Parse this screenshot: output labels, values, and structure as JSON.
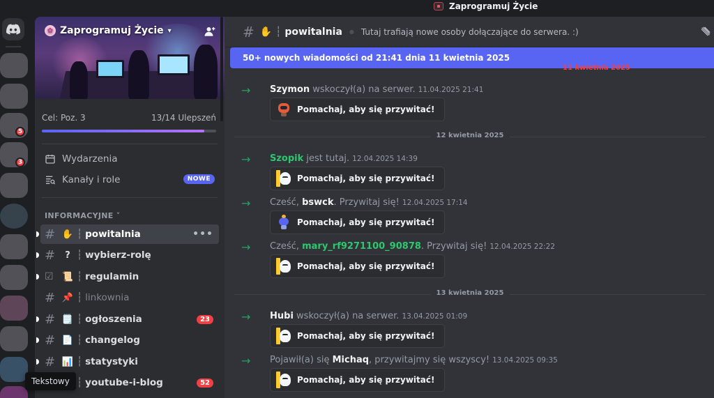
{
  "window": {
    "title": "Zaprogramuj Życie"
  },
  "rail": {
    "badges": [
      "5",
      "3"
    ]
  },
  "server": {
    "name": "Zaprogramuj Życie",
    "boost_goal": "Cel: Poz. 3",
    "boost_count": "13/14 Ulepszeń",
    "boost_progress": 0.93
  },
  "sidebar": {
    "events_label": "Wydarzenia",
    "channels_roles_label": "Kanały i role",
    "new_badge": "NOWE",
    "category": "INFORMACYJNE",
    "channels": [
      {
        "emoji": "✋",
        "name": "powitalnia",
        "active": true
      },
      {
        "emoji": "?",
        "name": "wybierz-rolę"
      },
      {
        "emoji": "📜",
        "name": "regulamin"
      },
      {
        "emoji": "📌",
        "name": "linkownia",
        "muted": true
      },
      {
        "emoji": "🗒️",
        "name": "ogłoszenia",
        "count": "23"
      },
      {
        "emoji": "📄",
        "name": "changelog"
      },
      {
        "emoji": "📊",
        "name": "statystyki"
      },
      {
        "emoji": "",
        "name": "youtube-i-blog",
        "count": "52"
      }
    ],
    "tooltip": "Tekstowy"
  },
  "channel": {
    "emoji": "✋",
    "name": "powitalnia",
    "topic": "Tutaj trafiają nowe osoby dołączające do serwera. :)"
  },
  "new_messages_bar": "50+ nowych wiadomości od 21:41 dnia 11 kwietnia 2025",
  "ghost_date": "11 kwietnia 2025",
  "wave_label": "Pomachaj, aby się przywitać!",
  "messages": [
    {
      "pre": "",
      "user": "Szymon",
      "post": " wskoczył(a) na serwer.",
      "time": "11.04.2025 21:41"
    },
    {
      "pre": "",
      "user": "Szopik",
      "post": " jest tutaj.",
      "time": "12.04.2025 14:39"
    },
    {
      "pre": "Cześć, ",
      "user": "bswck",
      "post": ". Przywitaj się!",
      "time": "12.04.2025 17:14"
    },
    {
      "pre": "Cześć, ",
      "user": "mary_rf9271100_90878",
      "post": ". Przywitaj się!",
      "time": "12.04.2025 22:22"
    },
    {
      "pre": "",
      "user": "Hubi",
      "post": " wskoczył(a) na serwer.",
      "time": "13.04.2025 01:09"
    },
    {
      "pre": "Pojawił(a) się ",
      "user": "Michaq",
      "post": ", przywitajmy się wszyscy!",
      "time": "13.04.2025 09:35"
    }
  ],
  "date_separators": [
    "12 kwietnia 2025",
    "13 kwietnia 2025"
  ],
  "colors": {
    "accent": "#5865f2",
    "join_arrow": "#23a55a",
    "mention_badge": "#f23f43"
  }
}
